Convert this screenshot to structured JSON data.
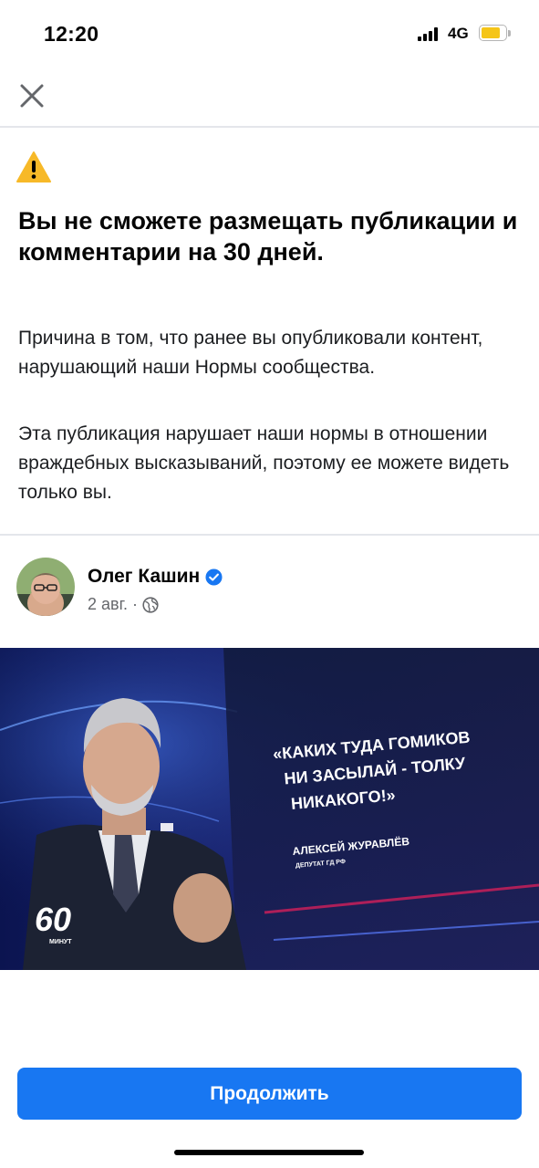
{
  "status_bar": {
    "time": "12:20",
    "network": "4G",
    "battery_color": "#f5c518"
  },
  "notice": {
    "icon": "warning-icon",
    "accent_color": "#f7b928",
    "title": "Вы не сможете размещать публикации и комментарии на 30 дней.",
    "reason": "Причина в том, что ранее вы опубликовали контент, нарушающий наши Нормы сообщества.",
    "details": "Эта публикация нарушает наши нормы в отношении враждебных высказываний, поэтому ее можете видеть только вы."
  },
  "post": {
    "author": "Олег Кашин",
    "verified_icon": "verified-badge-icon",
    "date": "2 авг.",
    "separator": "·",
    "audience_icon": "globe-icon",
    "image": {
      "quote": "«КАКИХ ТУДА ГОМИКОВ НИ ЗАСЫЛАЙ - ТОЛКУ НИКАКОГО!»",
      "speaker": "АЛЕКСЕЙ ЖУРАВЛЁВ",
      "speaker_title": "ДЕПУТАТ ГД РФ",
      "show_logo": "60",
      "show_logo_sub": "МИНУТ"
    }
  },
  "actions": {
    "continue_label": "Продолжить",
    "button_color": "#1877f2"
  }
}
